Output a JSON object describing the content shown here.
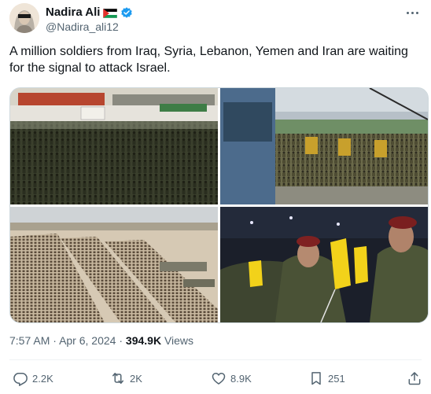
{
  "author": {
    "display_name": "Nadira Ali",
    "handle": "@Nadira_ali12"
  },
  "tweet": {
    "text": "A million soldiers from Iraq, Syria, Lebanon, Yemen and Iran are waiting for the signal to attack Israel."
  },
  "meta": {
    "time": "7:57 AM",
    "separator": "·",
    "date": "Apr 6, 2024",
    "views_count": "394.9K",
    "views_label": "Views"
  },
  "actions": {
    "replies": "2.2K",
    "reposts": "2K",
    "likes": "8.9K",
    "bookmarks": "251"
  },
  "icons": {
    "verified": "verified-badge-icon",
    "flag": "palestine-flag-icon",
    "more": "more-icon",
    "reply": "reply-icon",
    "retweet": "retweet-icon",
    "like": "heart-icon",
    "bookmark": "bookmark-icon",
    "share": "share-icon"
  },
  "colors": {
    "text_primary": "#0f1419",
    "text_secondary": "#536471",
    "verified_blue": "#1d9bf0",
    "border": "#cfd9de"
  }
}
